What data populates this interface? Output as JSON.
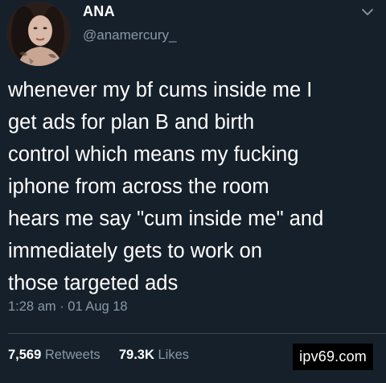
{
  "tweet": {
    "display_name": "ANA",
    "handle": "@anamercury_",
    "text": "whenever my bf cums inside me I\nget ads for plan B and birth\ncontrol which means my fucking\niphone from across the room\nhears me say \"cum inside me\" and\nimmediately gets to work on\nthose targeted ads",
    "timestamp": "1:28 am · 01 Aug 18",
    "retweets_count": "7,569",
    "retweets_label": "Retweets",
    "likes_count": "79.3K",
    "likes_label": "Likes"
  },
  "watermark": "ipv69.com",
  "icons": {
    "menu": "chevron-down-icon"
  },
  "colors": {
    "background": "#16202b",
    "text": "#ffffff",
    "secondary": "#8899a6",
    "divider": "#38444d"
  }
}
